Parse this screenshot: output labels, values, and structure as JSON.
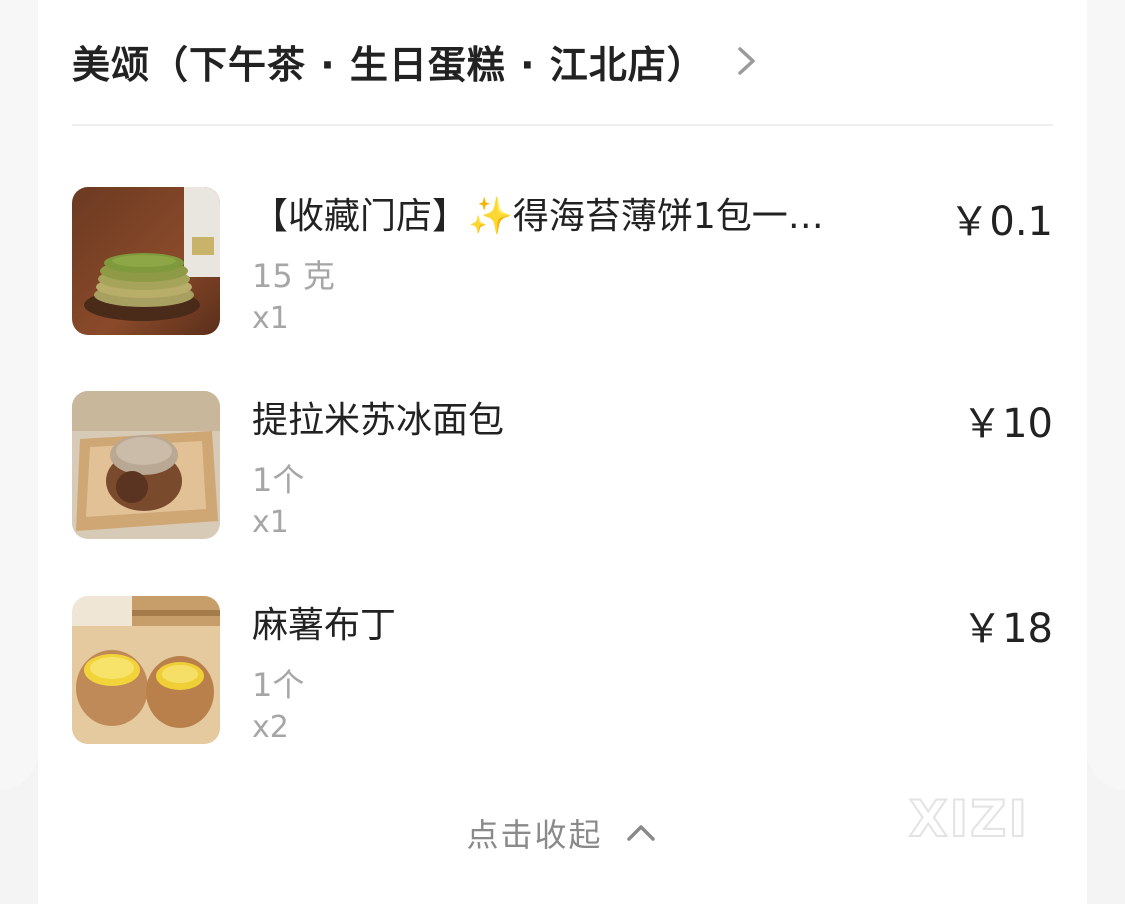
{
  "store": {
    "name": "美颂（下午茶 · 生日蛋糕 · 江北店）"
  },
  "items": [
    {
      "name": "【收藏门店】✨得海苔薄饼1包一…",
      "price": "￥0.1",
      "spec": "15 克",
      "qty": "x1"
    },
    {
      "name": "提拉米苏冰面包",
      "price": "￥10",
      "spec": "1个",
      "qty": "x1"
    },
    {
      "name": "麻薯布丁",
      "price": "￥18",
      "spec": "1个",
      "qty": "x2"
    }
  ],
  "footer": {
    "collapse_label": "点击收起"
  },
  "watermark": {
    "text": "XIZI"
  },
  "colors": {
    "text_primary": "#222222",
    "text_secondary": "#a6a6a6",
    "collapse_text": "#8a8a8a",
    "divider": "#eeeeee"
  },
  "icons": {
    "header_chevron": "chevron-right-icon",
    "collapse_chevron": "chevron-up-icon"
  }
}
